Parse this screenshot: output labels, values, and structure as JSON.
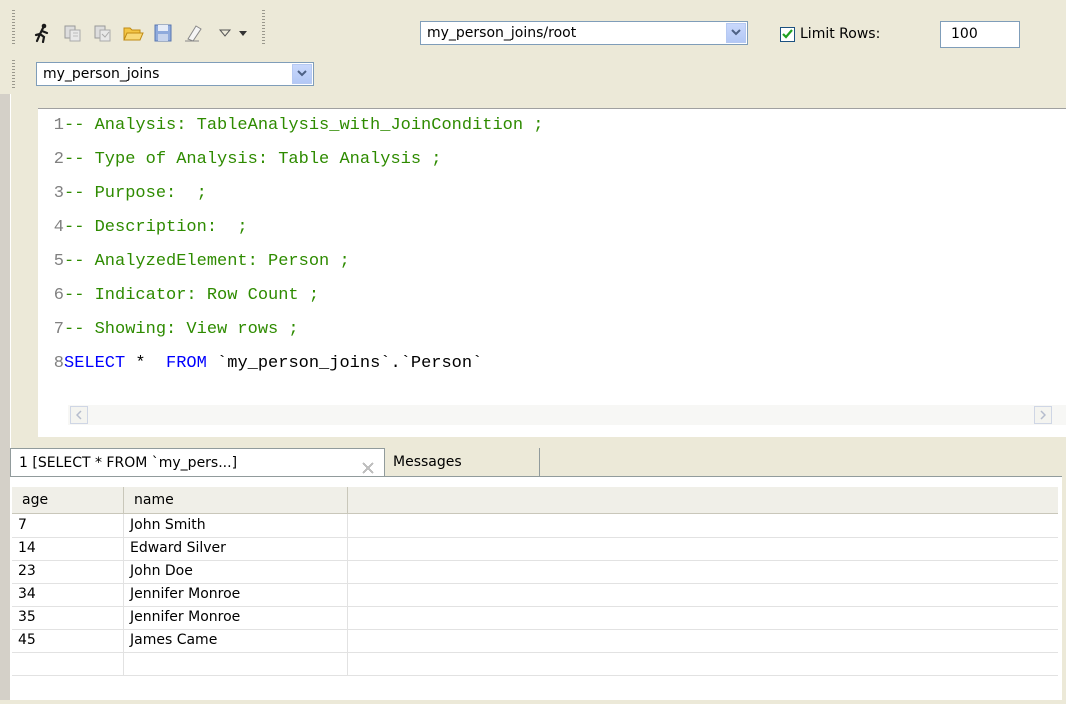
{
  "toolbar": {
    "connection_value": "my_person_joins/root",
    "limit_rows_label": "Limit Rows:",
    "limit_rows_checked": true,
    "limit_rows_value": "100",
    "database_value": "my_person_joins",
    "icons": [
      "run-icon",
      "execute-icon",
      "execute-all-icon",
      "open-folder-icon",
      "save-icon",
      "clear-icon",
      "view-menu-icon",
      "dropdown-icon"
    ]
  },
  "editor": {
    "lines": [
      {
        "num": "1",
        "text": "-- Analysis: TableAnalysis_with_JoinCondition ;"
      },
      {
        "num": "2",
        "text": "-- Type of Analysis: Table Analysis ;"
      },
      {
        "num": "3",
        "text": "-- Purpose:  ;"
      },
      {
        "num": "4",
        "text": "-- Description:  ;"
      },
      {
        "num": "5",
        "text": "-- AnalyzedElement: Person ;"
      },
      {
        "num": "6",
        "text": "-- Indicator: Row Count ;"
      },
      {
        "num": "7",
        "text": "-- Showing: View rows ;"
      }
    ],
    "sql_line": {
      "num": "8",
      "kw_select": "SELECT",
      "star": " *  ",
      "kw_from": "FROM",
      "rest": " `my_person_joins`.`Person`"
    }
  },
  "results": {
    "tabs": [
      {
        "label": "1 [SELECT * FROM `my_pers...]"
      },
      {
        "label": "Messages"
      }
    ],
    "columns": [
      "age",
      "name"
    ],
    "rows": [
      [
        "7",
        "John Smith"
      ],
      [
        "14",
        "Edward Silver"
      ],
      [
        "23",
        "John Doe"
      ],
      [
        "34",
        "Jennifer Monroe"
      ],
      [
        "35",
        "Jennifer Monroe"
      ],
      [
        "45",
        "James Came"
      ]
    ]
  },
  "colors": {
    "comment": "#2e8b00",
    "keyword": "#0000ff",
    "background": "#ece9d8"
  }
}
